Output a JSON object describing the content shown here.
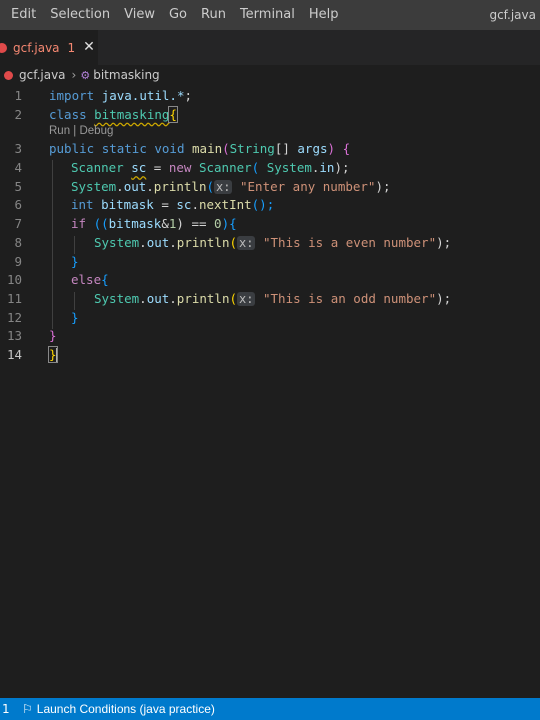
{
  "menubar": {
    "items": [
      "Edit",
      "Selection",
      "View",
      "Go",
      "Run",
      "Terminal",
      "Help"
    ],
    "window_title": "gcf.java"
  },
  "tab": {
    "label": "gcf.java",
    "badge": "1",
    "close": "✕"
  },
  "breadcrumb": {
    "file": "gcf.java",
    "symbol": "bitmasking"
  },
  "editor": {
    "line_numbers": [
      "1",
      "2",
      "3",
      "4",
      "5",
      "6",
      "7",
      "8",
      "9",
      "10",
      "11",
      "12",
      "13",
      "14"
    ],
    "code_lens": "Run | Debug",
    "hint": "x:",
    "lines": {
      "l1": [
        "import ",
        "java.util.*",
        ";"
      ],
      "l2": [
        "class ",
        "bitmasking",
        "{"
      ],
      "l3": [
        "public ",
        "static ",
        "void ",
        "main",
        "(",
        "String",
        "[] ",
        "args",
        ") ",
        "{"
      ],
      "l4": [
        "Scanner ",
        "sc",
        " = ",
        "new ",
        "Scanner",
        "( ",
        "System",
        ".",
        "in",
        ");"
      ],
      "l5": [
        "System",
        ".",
        "out",
        ".",
        "println",
        "(",
        "\"Enter any number\"",
        ");"
      ],
      "l6": [
        "int ",
        "bitmask",
        " = ",
        "sc",
        ".",
        "nextInt",
        "();"
      ],
      "l7": [
        "if ",
        "((",
        "bitmask",
        "&",
        "1",
        ") == ",
        "0",
        ")",
        "{"
      ],
      "l8": [
        "System",
        ".",
        "out",
        ".",
        "println",
        "(",
        "\"This is a even number\"",
        ");"
      ],
      "l9": [
        "}"
      ],
      "l10": [
        "else",
        "{"
      ],
      "l11": [
        "System",
        ".",
        "out",
        ".",
        "println",
        "(",
        "\"This is an odd number\"",
        ");"
      ],
      "l12": [
        "}"
      ],
      "l13": [
        "}"
      ],
      "l14": [
        "}"
      ]
    }
  },
  "statusbar": {
    "remote": "1",
    "launch": "Launch Conditions (java practice)"
  },
  "colors": {
    "accent": "#007acc",
    "error": "#e04a4a"
  }
}
